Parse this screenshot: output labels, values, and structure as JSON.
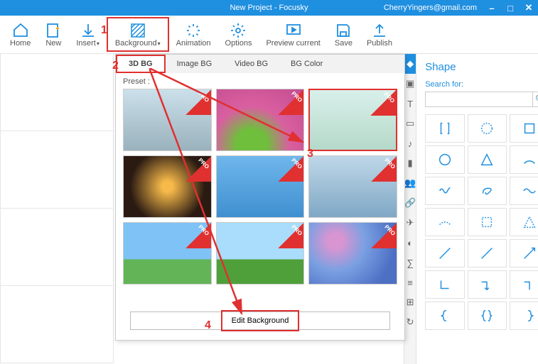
{
  "titlebar": {
    "title": "New Project - Focusky",
    "email": "CherryYingers@gmail.com"
  },
  "toolbar": {
    "home": "Home",
    "new": "New",
    "insert": "Insert",
    "background": "Background",
    "animation": "Animation",
    "options": "Options",
    "preview": "Preview current",
    "save": "Save",
    "publish": "Publish"
  },
  "bg_panel": {
    "tabs": {
      "threeD": "3D BG",
      "image": "Image BG",
      "video": "Video BG",
      "color": "BG Color"
    },
    "preset_label": "Preset :",
    "pro_badge": "PRO",
    "edit_button": "Edit Background"
  },
  "side_panel": {
    "title": "Shape",
    "search_label": "Search for:",
    "search_placeholder": ""
  },
  "annotations": {
    "n1": "1",
    "n2": "2",
    "n3": "3",
    "n4": "4"
  }
}
